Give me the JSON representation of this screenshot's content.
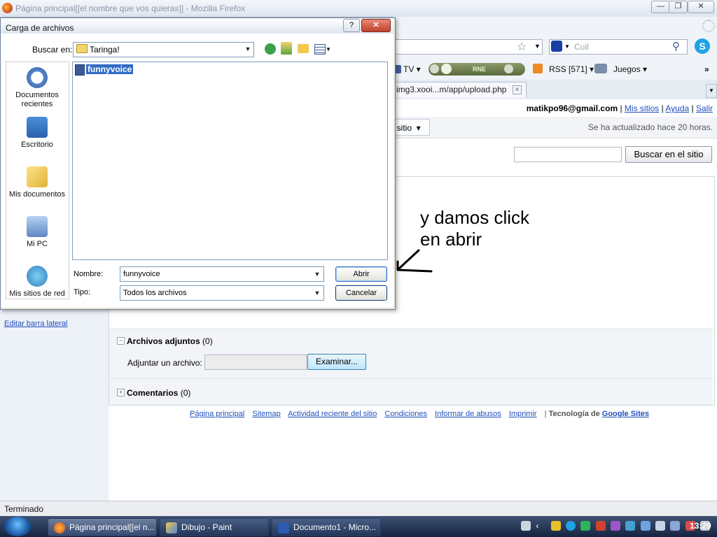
{
  "firefox": {
    "window_title": "Página principal[[el nombre que vos quieras]] - Mozilla Firefox",
    "search_placeholder": "Cuil",
    "bookmarks": {
      "tv": "TV",
      "radio": "RNE",
      "rss": "RSS [571]",
      "games": "Juegos",
      "more": "»"
    },
    "tab_url": "img3.xooi...m/app/upload.php"
  },
  "site": {
    "user_email": "matikpo96@gmail.com",
    "links": [
      "Mis sitios",
      "Ayuda",
      "Salir"
    ],
    "sitio_dropdown": "el sitio",
    "updated": "Se ha actualizado hace 20 horas.",
    "search_button": "Buscar en el sitio",
    "edit_sidebar": "Editar barra lateral",
    "attachments_header": "Archivos adjuntos",
    "attachments_count": "(0)",
    "attach_label": "Adjuntar un archivo:",
    "browse_button": "Examinar...",
    "comments_header": "Comentarios",
    "comments_count": "(0)",
    "footer_links": [
      "Página principal",
      "Sitemap",
      "Actividad reciente del sitio",
      "Condiciones",
      "Informar de abusos",
      "Imprimir"
    ],
    "footer_tech": "Tecnología de",
    "footer_google_sites": "Google Sites"
  },
  "annotation": {
    "line1": "y damos click",
    "line2": "en abrir"
  },
  "dialog": {
    "title": "Carga de archivos",
    "look_in_label": "Buscar en:",
    "look_in_value": "Taringa!",
    "places": [
      "Documentos recientes",
      "Escritorio",
      "Mis documentos",
      "Mi PC",
      "Mis sitios de red"
    ],
    "files": [
      "funnyvoice"
    ],
    "name_label": "Nombre:",
    "name_value": "funnyvoice",
    "type_label": "Tipo:",
    "type_value": "Todos los archivos",
    "open_button": "Abrir",
    "cancel_button": "Cancelar"
  },
  "status_bar": {
    "text": "Terminado"
  },
  "taskbar": {
    "items": [
      "Página principal[[el n...",
      "Dibujo - Paint",
      "Documento1 - Micro..."
    ],
    "clock": "13:29"
  },
  "colors": {
    "link": "#1f4fbf",
    "selection": "#316ac5",
    "taskbar": "#15243f"
  }
}
